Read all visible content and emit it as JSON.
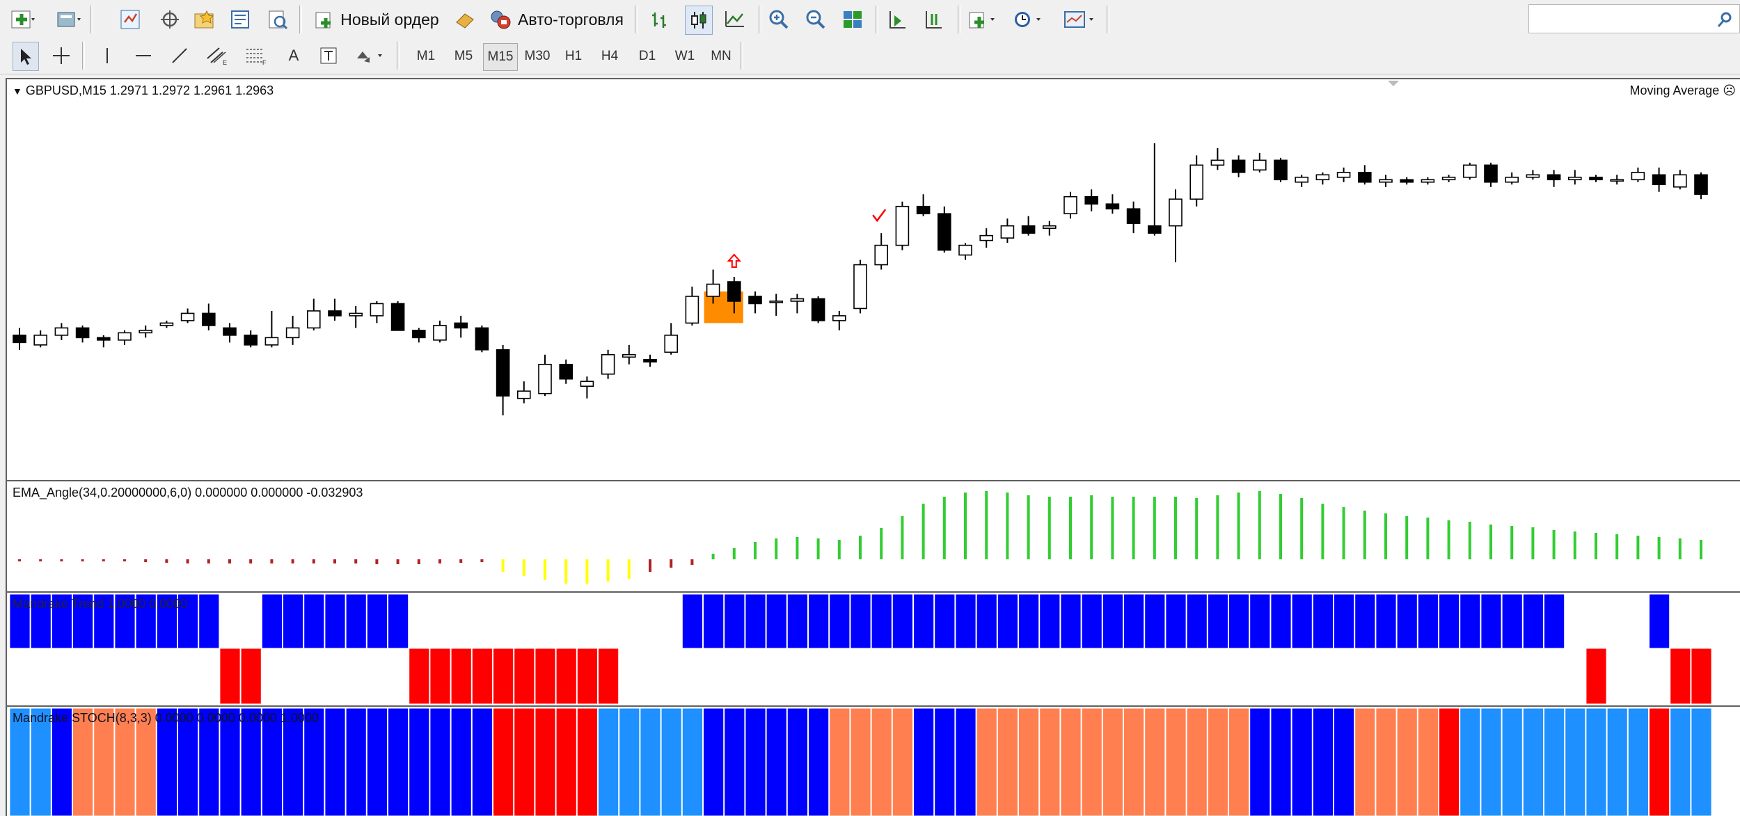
{
  "toolbar_main": {
    "new_order_label": "Новый ордер",
    "autotrading_label": "Авто-торговля"
  },
  "toolbar_draw": {
    "timeframes": [
      "M1",
      "M5",
      "M15",
      "M30",
      "H1",
      "H4",
      "D1",
      "W1",
      "MN"
    ],
    "active_timeframe": "M15",
    "text_tool_label": "A"
  },
  "chart": {
    "header": "GBPUSD,M15  1.2971 1.2972 1.2961 1.2963",
    "expert_label": "Moving Average",
    "bull_color": "#ffffff",
    "bear_color": "#000000",
    "signal_box_color": "#ff8c00",
    "arrow_color": "#ff0000"
  },
  "indicators": {
    "ema_label": "EMA_Angle(34,0.20000000,6,0) 0.000000 0.000000 -0.032903",
    "trend_label": "Mandrake Trend 1.0000 0.0000",
    "stoch_label": "Mandrake STOCH(8,3,3) 0.0000 0.0000 0.0000 1.0000"
  },
  "chart_data": {
    "type": "candlestick",
    "symbol": "GBPUSD",
    "timeframe": "M15",
    "last_ohlc": {
      "open": 1.2971,
      "high": 1.2972,
      "low": 1.2961,
      "close": 1.2963
    },
    "price_range": [
      1.285,
      1.3
    ],
    "candles": [
      [
        1.2905,
        1.2908,
        1.2899,
        1.2902
      ],
      [
        1.2901,
        1.2907,
        1.29,
        1.2905
      ],
      [
        1.2905,
        1.291,
        1.2903,
        1.2908
      ],
      [
        1.2908,
        1.2909,
        1.2902,
        1.2904
      ],
      [
        1.2904,
        1.2905,
        1.29,
        1.2903
      ],
      [
        1.2903,
        1.2907,
        1.2901,
        1.2906
      ],
      [
        1.2906,
        1.2909,
        1.2904,
        1.2907
      ],
      [
        1.2909,
        1.2911,
        1.2908,
        1.291
      ],
      [
        1.2911,
        1.2916,
        1.291,
        1.2914
      ],
      [
        1.2914,
        1.2918,
        1.2907,
        1.2909
      ],
      [
        1.2908,
        1.291,
        1.2902,
        1.2905
      ],
      [
        1.2905,
        1.2907,
        1.29,
        1.2901
      ],
      [
        1.2901,
        1.2915,
        1.29,
        1.2904
      ],
      [
        1.2904,
        1.2913,
        1.2901,
        1.2908
      ],
      [
        1.2908,
        1.292,
        1.2907,
        1.2915
      ],
      [
        1.2915,
        1.292,
        1.2911,
        1.2913
      ],
      [
        1.2913,
        1.2917,
        1.2908,
        1.2914
      ],
      [
        1.2913,
        1.2919,
        1.291,
        1.2918
      ],
      [
        1.2918,
        1.2919,
        1.2908,
        1.2907
      ],
      [
        1.2907,
        1.2908,
        1.2902,
        1.2904
      ],
      [
        1.2903,
        1.2911,
        1.2902,
        1.2909
      ],
      [
        1.291,
        1.2913,
        1.2904,
        1.2908
      ],
      [
        1.2908,
        1.2909,
        1.2898,
        1.2899
      ],
      [
        1.2899,
        1.2901,
        1.2872,
        1.288
      ],
      [
        1.2879,
        1.2886,
        1.2877,
        1.2882
      ],
      [
        1.2881,
        1.2897,
        1.288,
        1.2893
      ],
      [
        1.2893,
        1.2895,
        1.2885,
        1.2887
      ],
      [
        1.2884,
        1.2888,
        1.2879,
        1.2886
      ],
      [
        1.2889,
        1.2899,
        1.2887,
        1.2897
      ],
      [
        1.2896,
        1.2901,
        1.2893,
        1.2897
      ],
      [
        1.2895,
        1.2897,
        1.2892,
        1.2894
      ],
      [
        1.2898,
        1.291,
        1.2897,
        1.2905
      ],
      [
        1.291,
        1.2925,
        1.2909,
        1.2921
      ],
      [
        1.2921,
        1.2932,
        1.2918,
        1.2926
      ],
      [
        1.2927,
        1.2929,
        1.2914,
        1.2919
      ],
      [
        1.2921,
        1.2923,
        1.2914,
        1.2918
      ],
      [
        1.2919,
        1.2922,
        1.2913,
        1.2919
      ],
      [
        1.2919,
        1.2922,
        1.2914,
        1.292
      ],
      [
        1.292,
        1.2921,
        1.291,
        1.2911
      ],
      [
        1.2911,
        1.2915,
        1.2907,
        1.2913
      ],
      [
        1.2916,
        1.2936,
        1.2914,
        1.2934
      ],
      [
        1.2934,
        1.2947,
        1.2932,
        1.2942
      ],
      [
        1.2942,
        1.296,
        1.294,
        1.2958
      ],
      [
        1.2958,
        1.2963,
        1.2954,
        1.2955
      ],
      [
        1.2955,
        1.2958,
        1.2939,
        1.294
      ],
      [
        1.2938,
        1.2943,
        1.2936,
        1.2942
      ],
      [
        1.2944,
        1.2949,
        1.2941,
        1.2946
      ],
      [
        1.2945,
        1.2953,
        1.2943,
        1.295
      ],
      [
        1.295,
        1.2954,
        1.2946,
        1.2947
      ],
      [
        1.2949,
        1.2952,
        1.2946,
        1.295
      ],
      [
        1.2955,
        1.2964,
        1.2953,
        1.2962
      ],
      [
        1.2962,
        1.2965,
        1.2956,
        1.2959
      ],
      [
        1.2959,
        1.2963,
        1.2955,
        1.2957
      ],
      [
        1.2957,
        1.296,
        1.2947,
        1.2951
      ],
      [
        1.295,
        1.2984,
        1.2946,
        1.2947
      ],
      [
        1.295,
        1.2965,
        1.2935,
        1.2961
      ],
      [
        1.2961,
        1.2979,
        1.2958,
        1.2975
      ],
      [
        1.2975,
        1.2982,
        1.2973,
        1.2977
      ],
      [
        1.2977,
        1.2979,
        1.297,
        1.2972
      ],
      [
        1.2973,
        1.298,
        1.2972,
        1.2977
      ],
      [
        1.2977,
        1.2978,
        1.2968,
        1.2969
      ],
      [
        1.2968,
        1.2971,
        1.2966,
        1.297
      ],
      [
        1.2969,
        1.2972,
        1.2967,
        1.2971
      ],
      [
        1.297,
        1.2974,
        1.2968,
        1.2972
      ],
      [
        1.2972,
        1.2975,
        1.2967,
        1.2968
      ],
      [
        1.2968,
        1.2971,
        1.2966,
        1.2969
      ],
      [
        1.2969,
        1.297,
        1.2967,
        1.2968
      ],
      [
        1.2968,
        1.297,
        1.2967,
        1.2969
      ],
      [
        1.2969,
        1.2971,
        1.2968,
        1.297
      ],
      [
        1.297,
        1.2976,
        1.2969,
        1.2975
      ],
      [
        1.2975,
        1.2976,
        1.2966,
        1.2968
      ],
      [
        1.2968,
        1.2972,
        1.2967,
        1.297
      ],
      [
        1.297,
        1.2973,
        1.2969,
        1.2971
      ],
      [
        1.2971,
        1.2973,
        1.2966,
        1.2969
      ],
      [
        1.2969,
        1.2973,
        1.2967,
        1.297
      ],
      [
        1.297,
        1.2971,
        1.2968,
        1.2969
      ],
      [
        1.2969,
        1.2971,
        1.2967,
        1.2969
      ],
      [
        1.2969,
        1.2974,
        1.2968,
        1.2972
      ],
      [
        1.2971,
        1.2974,
        1.2964,
        1.2967
      ],
      [
        1.2966,
        1.2973,
        1.2965,
        1.2971
      ],
      [
        1.2971,
        1.2972,
        1.2961,
        1.2963
      ]
    ],
    "signal_up_arrow_index": 34,
    "checkmark_index": 41,
    "signal_box_indices": [
      33,
      34
    ],
    "ema_angle_values": [
      -0.02,
      -0.02,
      -0.02,
      -0.02,
      -0.03,
      -0.03,
      -0.04,
      -0.05,
      -0.06,
      -0.06,
      -0.06,
      -0.06,
      -0.06,
      -0.06,
      -0.06,
      -0.06,
      -0.06,
      -0.07,
      -0.07,
      -0.07,
      -0.06,
      -0.05,
      -0.04,
      -0.18,
      -0.24,
      -0.3,
      -0.35,
      -0.35,
      -0.32,
      -0.28,
      -0.18,
      -0.12,
      -0.08,
      0.08,
      0.16,
      0.25,
      0.3,
      0.32,
      0.3,
      0.28,
      0.34,
      0.45,
      0.62,
      0.8,
      0.9,
      0.96,
      0.98,
      0.96,
      0.92,
      0.9,
      0.9,
      0.92,
      0.9,
      0.9,
      0.9,
      0.9,
      0.88,
      0.92,
      0.96,
      0.98,
      0.94,
      0.88,
      0.8,
      0.75,
      0.7,
      0.66,
      0.62,
      0.6,
      0.56,
      0.54,
      0.5,
      0.48,
      0.46,
      0.42,
      0.4,
      0.38,
      0.36,
      0.34,
      0.32,
      0.3,
      0.28
    ],
    "ema_state": [
      "d",
      "d",
      "d",
      "d",
      "d",
      "d",
      "d",
      "d",
      "d",
      "d",
      "d",
      "d",
      "d",
      "d",
      "d",
      "d",
      "d",
      "d",
      "d",
      "d",
      "d",
      "d",
      "d",
      "y",
      "y",
      "y",
      "y",
      "y",
      "y",
      "y",
      "d",
      "d",
      "d",
      "g",
      "g",
      "g",
      "g",
      "g",
      "g",
      "g",
      "g",
      "g",
      "g",
      "g",
      "g",
      "g",
      "g",
      "g",
      "g",
      "g",
      "g",
      "g",
      "g",
      "g",
      "g",
      "g",
      "g",
      "g",
      "g",
      "g",
      "g",
      "g",
      "g",
      "g",
      "g",
      "g",
      "g",
      "g",
      "g",
      "g",
      "g",
      "g",
      "g",
      "g",
      "g",
      "g",
      "g",
      "g",
      "g",
      "g",
      "g"
    ],
    "trend_state": [
      "u",
      "u",
      "u",
      "u",
      "u",
      "u",
      "u",
      "u",
      "u",
      "u",
      "d",
      "d",
      "u",
      "u",
      "u",
      "u",
      "u",
      "u",
      "u",
      "d",
      "d",
      "d",
      "d",
      "d",
      "d",
      "d",
      "d",
      "d",
      "d",
      "n",
      "n",
      "n",
      "u",
      "u",
      "u",
      "u",
      "u",
      "u",
      "u",
      "u",
      "u",
      "u",
      "u",
      "u",
      "u",
      "u",
      "u",
      "u",
      "u",
      "u",
      "u",
      "u",
      "u",
      "u",
      "u",
      "u",
      "u",
      "u",
      "u",
      "u",
      "u",
      "u",
      "u",
      "u",
      "u",
      "u",
      "u",
      "u",
      "u",
      "u",
      "u",
      "u",
      "u",
      "u",
      "n",
      "d",
      "n",
      "n",
      "u",
      "d",
      "d"
    ],
    "stoch_state": [
      "l",
      "l",
      "b",
      "o",
      "o",
      "o",
      "o",
      "b",
      "b",
      "b",
      "b",
      "b",
      "b",
      "b",
      "b",
      "b",
      "b",
      "b",
      "b",
      "b",
      "b",
      "b",
      "b",
      "r",
      "r",
      "r",
      "r",
      "r",
      "l",
      "l",
      "l",
      "l",
      "l",
      "b",
      "b",
      "b",
      "b",
      "b",
      "b",
      "o",
      "o",
      "o",
      "o",
      "b",
      "b",
      "b",
      "o",
      "o",
      "o",
      "o",
      "o",
      "o",
      "o",
      "o",
      "o",
      "o",
      "o",
      "o",
      "o",
      "b",
      "b",
      "b",
      "b",
      "b",
      "o",
      "o",
      "o",
      "o",
      "r",
      "l",
      "l",
      "l",
      "l",
      "l",
      "l",
      "l",
      "l",
      "l",
      "r",
      "l",
      "l"
    ],
    "colors": {
      "ema_dark": "#b22222",
      "ema_yellow": "#ffff00",
      "ema_green": "#32cd32",
      "trend_up": "#0000ff",
      "trend_down": "#ff0000",
      "stoch_light": "#1e90ff",
      "stoch_blue": "#0000ff",
      "stoch_orange": "#ff7f50",
      "stoch_red": "#ff0000"
    }
  }
}
